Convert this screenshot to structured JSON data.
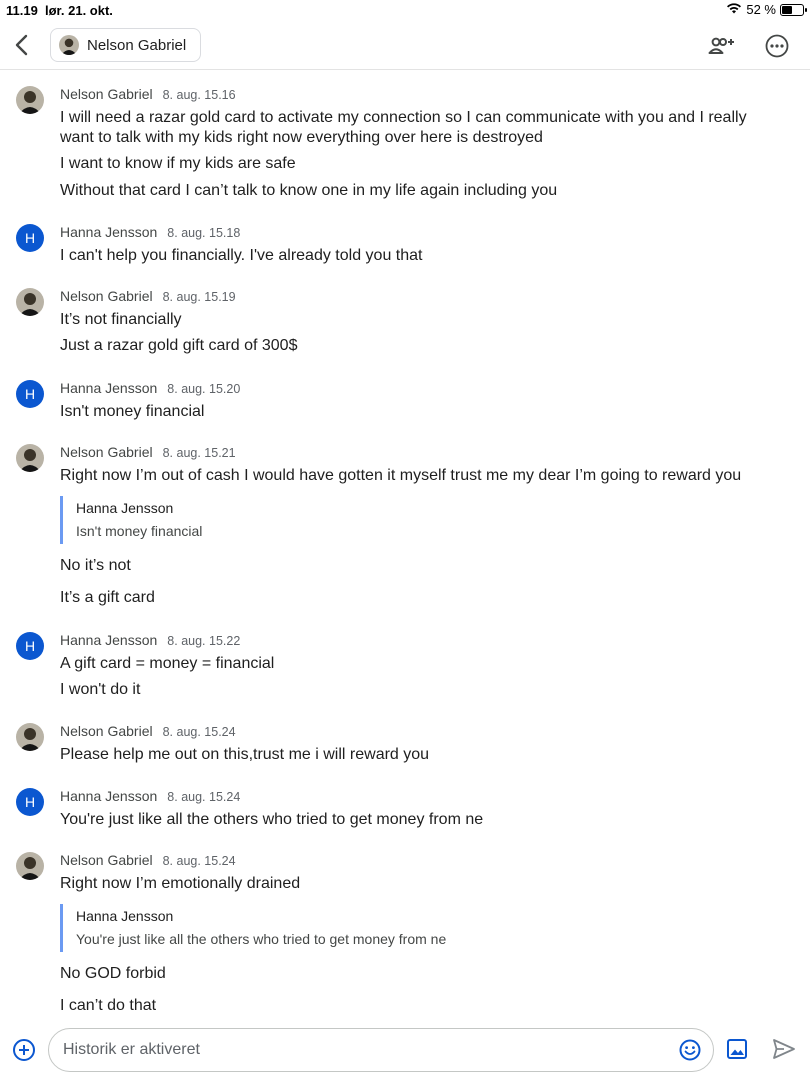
{
  "status_bar": {
    "time": "11.19",
    "date": "lør. 21. okt.",
    "battery": "52 %",
    "battery_level": 0.52
  },
  "header": {
    "contact_name": "Nelson Gabriel"
  },
  "messages": [
    {
      "sender": "Nelson Gabriel",
      "time": "8. aug. 15.16",
      "texts": [
        "I will need a razar gold card to activate my connection so I can communicate with you and I really want to talk with my kids right now everything over here is destroyed",
        "I want to know if my kids are safe",
        "Without that card I can’t talk to know one in my life again including you"
      ]
    },
    {
      "sender": "Hanna Jensson",
      "initial": "H",
      "time": "8. aug. 15.18",
      "texts": [
        "I can't help you financially. I've already told you that"
      ]
    },
    {
      "sender": "Nelson Gabriel",
      "time": "8. aug. 15.19",
      "texts": [
        "It’s not financially",
        "Just a razar gold gift card of 300$"
      ]
    },
    {
      "sender": "Hanna Jensson",
      "initial": "H",
      "time": "8. aug. 15.20",
      "texts": [
        "Isn't money financial"
      ]
    },
    {
      "sender": "Nelson Gabriel",
      "time": "8. aug. 15.21",
      "text_before": "Right now I’m out of cash I would have gotten it myself trust me my dear I’m going to reward you",
      "quote": {
        "sender": "Hanna Jensson",
        "text": "Isn't money financial"
      },
      "texts_after": [
        "No it’s not",
        "It’s a gift card"
      ]
    },
    {
      "sender": "Hanna Jensson",
      "initial": "H",
      "time": "8. aug. 15.22",
      "texts": [
        "A gift card = money = financial",
        "I won't do it"
      ]
    },
    {
      "sender": "Nelson Gabriel",
      "time": "8. aug. 15.24",
      "texts": [
        "Please help me out on this,trust me i will reward you"
      ]
    },
    {
      "sender": "Hanna Jensson",
      "initial": "H",
      "time": "8. aug. 15.24",
      "texts": [
        "You're just like all the others who tried to get money from ne"
      ]
    },
    {
      "sender": "Nelson Gabriel",
      "time": "8. aug. 15.24",
      "text_before": "Right now I’m emotionally drained",
      "quote": {
        "sender": "Hanna Jensson",
        "text": "You're just like all the others who tried to get money from ne"
      },
      "texts_after": [
        "No GOD forbid",
        "I can’t do that"
      ]
    }
  ],
  "composer": {
    "placeholder": "Historik er aktiveret"
  },
  "colors": {
    "accent": "#0b57d0",
    "quote_bar": "#6b9af2",
    "text": "#1f1f1f",
    "meta": "#5f6368"
  },
  "icons": {
    "back": "chevron-left-icon",
    "add_people": "add-people-icon",
    "more": "more-horizontal-icon",
    "plus": "plus-circle-icon",
    "emoji": "emoji-icon",
    "image": "image-icon",
    "send": "send-icon",
    "wifi": "wifi-icon",
    "battery": "battery-icon",
    "avatar_photo": "person-photo-icon"
  }
}
